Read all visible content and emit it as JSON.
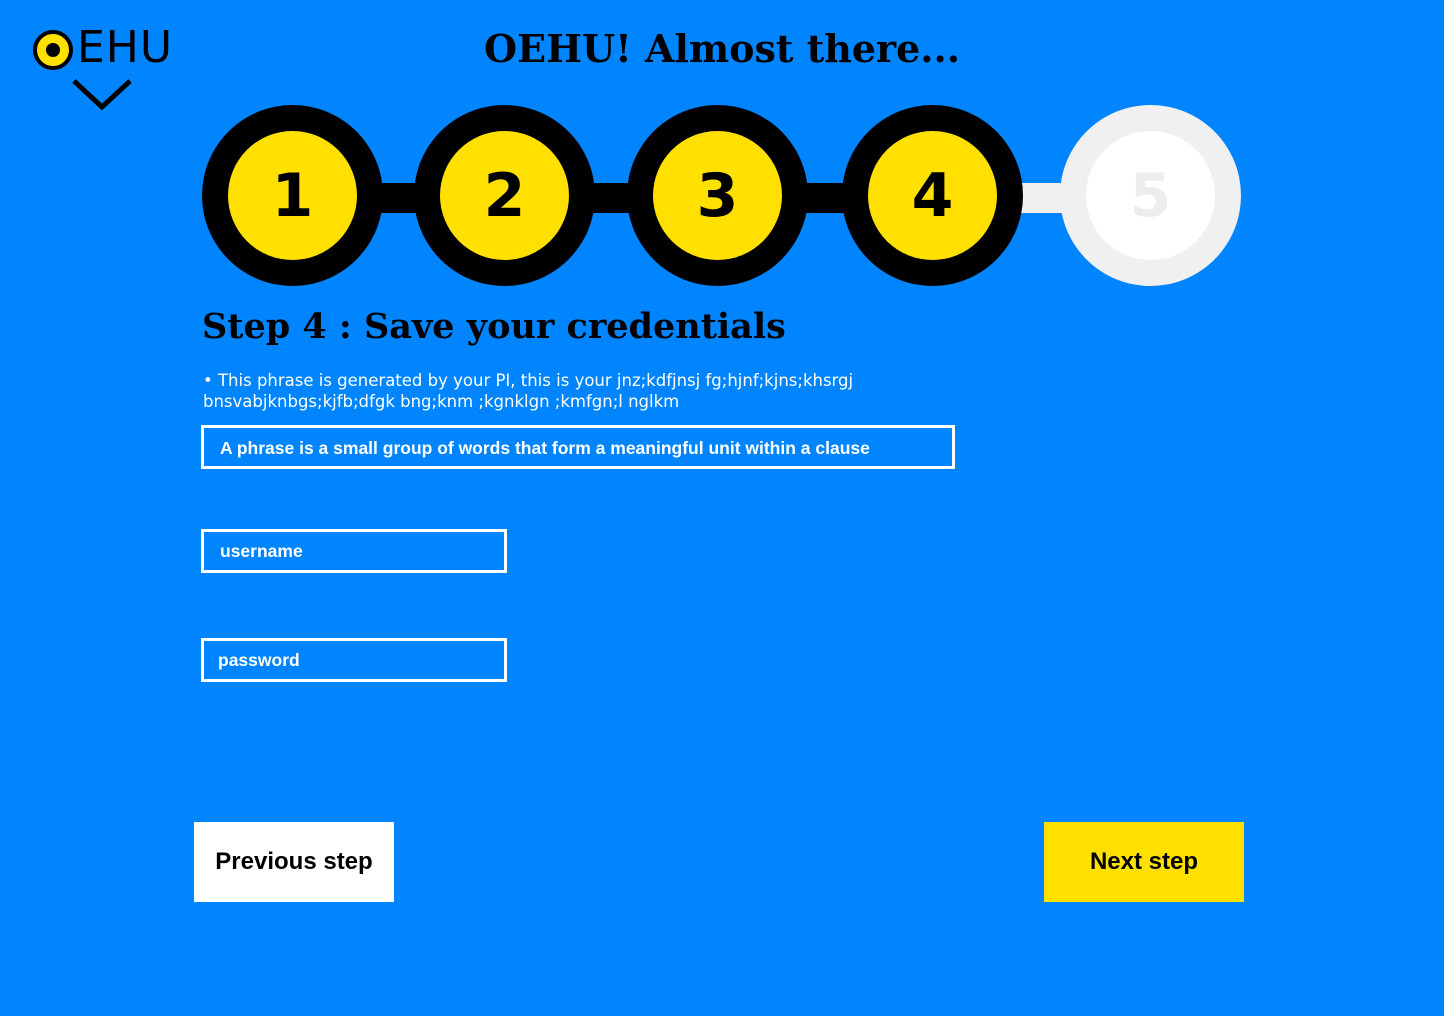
{
  "brand": {
    "logo_text": "EHU",
    "accent": "#FFE000",
    "background": "#0085FF"
  },
  "header": {
    "title": "OEHU! Almost there..."
  },
  "stepper": {
    "current_step": 4,
    "steps": [
      {
        "label": "1",
        "state": "complete"
      },
      {
        "label": "2",
        "state": "complete"
      },
      {
        "label": "3",
        "state": "complete"
      },
      {
        "label": "4",
        "state": "complete"
      },
      {
        "label": "5",
        "state": "pending"
      }
    ]
  },
  "main": {
    "heading": "Step 4 : Save your credentials",
    "description": "• This phrase is generated by your PI, this is your jnz;kdfjnsj fg;hjnf;kjns;khsrgj bnsvabjknbgs;kjfb;dfgk bng;knm ;kgnklgn ;kmfgn;l nglkm",
    "phrase": "A phrase is a small group of words that form a meaningful unit within a clause",
    "username": {
      "value": "",
      "placeholder": "username"
    },
    "password": {
      "value": "",
      "placeholder": "password"
    }
  },
  "footer": {
    "previous_label": "Previous step",
    "next_label": "Next step"
  }
}
